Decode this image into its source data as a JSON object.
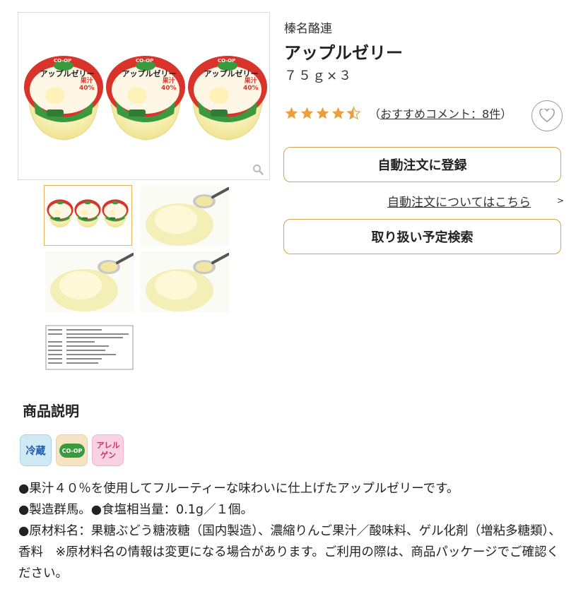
{
  "product": {
    "maker": "榛名酪連",
    "title": "アップルゼリー",
    "size": "７５ｇ×３",
    "rating": 4.5,
    "comments_open": "（",
    "comments_label": "おすすめコメント：8件",
    "comments_close": "）"
  },
  "gallery": {
    "package_brand": "CO-OP",
    "package_name": "アップルゼリー",
    "juice_label": "果汁",
    "juice_value": "40%",
    "thumbnails": [
      "package",
      "jelly-spoon-1",
      "jelly-spoon-2",
      "jelly-spoon-3",
      "label"
    ]
  },
  "actions": {
    "auto_order_label": "自動注文に登録",
    "auto_order_link": "自動注文についてはこちら",
    "link_chevron": ">",
    "handling_label": "取り扱い予定検索"
  },
  "description": {
    "heading": "商品説明",
    "badges": [
      {
        "text": "冷蔵",
        "bg": "#cfe9f5",
        "color": "#1c5aa8"
      },
      {
        "text": "CO-OP",
        "bg": "#f6e3c2",
        "color": "#ffffff"
      },
      {
        "text": "アレルゲン",
        "bg": "#f8d2e3",
        "color": "#d0306a"
      }
    ],
    "lines": [
      "●果汁４０％を使用してフルーティーな味わいに仕上げたアップルゼリーです。",
      "●製造群馬。●食塩相当量：0.1g／１個。",
      "●原材料名：果糖ぶどう糖液糖（国内製造）、濃縮りんご果汁／酸味料、ゲル化剤（増粘多糖類）、香料　※原材料名の情報は変更になる場合があります。ご利用の際は、商品パッケージでご確認ください。"
    ]
  },
  "colors": {
    "star": "#e8a13a",
    "button_border": "#d4a34e",
    "package_red": "#d8342c",
    "package_green": "#3a9a3e",
    "jelly": "#f3e9a0"
  }
}
